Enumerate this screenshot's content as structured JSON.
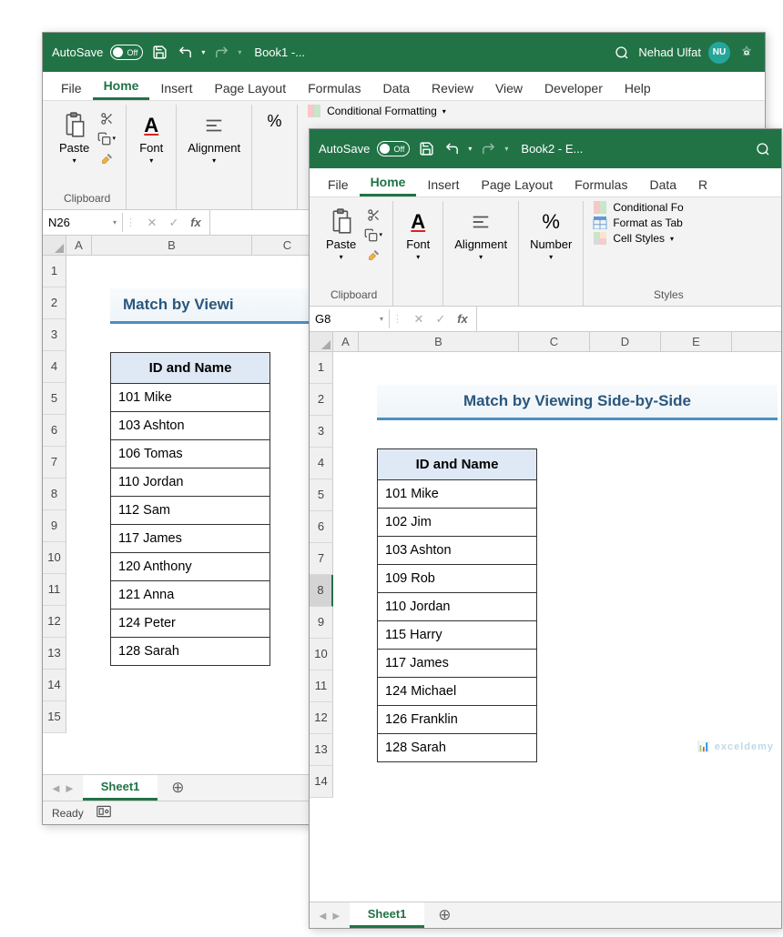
{
  "win1": {
    "autosave": "AutoSave",
    "autosave_state": "Off",
    "title": "Book1 -...",
    "user": "Nehad Ulfat",
    "avatar": "NU",
    "tabs": [
      "File",
      "Home",
      "Insert",
      "Page Layout",
      "Formulas",
      "Data",
      "Review",
      "View",
      "Developer",
      "Help"
    ],
    "active_tab": "Home",
    "groups": {
      "clipboard": "Clipboard",
      "font": "Font",
      "alignment": "Alignment",
      "paste": "Paste"
    },
    "styles": {
      "cond": "Conditional Formatting"
    },
    "namebox": "N26",
    "sheet_title": "Match by Viewi",
    "header": "ID and Name",
    "rows": [
      "101 Mike",
      "103 Ashton",
      "106 Tomas",
      "110 Jordan",
      "112 Sam",
      "117 James",
      "120 Anthony",
      "121 Anna",
      "124 Peter",
      "128 Sarah"
    ],
    "col_letters": [
      "A",
      "B",
      "C"
    ],
    "row_nums": [
      "1",
      "2",
      "3",
      "4",
      "5",
      "6",
      "7",
      "8",
      "9",
      "10",
      "11",
      "12",
      "13",
      "14",
      "15"
    ],
    "sheet_tab": "Sheet1",
    "status": "Ready"
  },
  "win2": {
    "autosave": "AutoSave",
    "autosave_state": "Off",
    "title": "Book2 - E...",
    "tabs": [
      "File",
      "Home",
      "Insert",
      "Page Layout",
      "Formulas",
      "Data",
      "R"
    ],
    "active_tab": "Home",
    "groups": {
      "clipboard": "Clipboard",
      "font": "Font",
      "alignment": "Alignment",
      "number": "Number",
      "paste": "Paste",
      "styles": "Styles"
    },
    "styles": {
      "cond": "Conditional Fo",
      "table": "Format as Tab",
      "cell": "Cell Styles"
    },
    "namebox": "G8",
    "sel_row": "8",
    "sheet_title": "Match by Viewing Side-by-Side",
    "header": "ID and Name",
    "rows": [
      "101 Mike",
      "102 Jim",
      "103 Ashton",
      "109 Rob",
      "110 Jordan",
      "115 Harry",
      "117 James",
      "124 Michael",
      "126 Franklin",
      "128 Sarah"
    ],
    "col_letters": [
      "A",
      "B",
      "C",
      "D",
      "E"
    ],
    "row_nums": [
      "1",
      "2",
      "3",
      "4",
      "5",
      "6",
      "7",
      "8",
      "9",
      "10",
      "11",
      "12",
      "13",
      "14"
    ],
    "sheet_tab": "Sheet1",
    "watermark": "exceldemy"
  }
}
